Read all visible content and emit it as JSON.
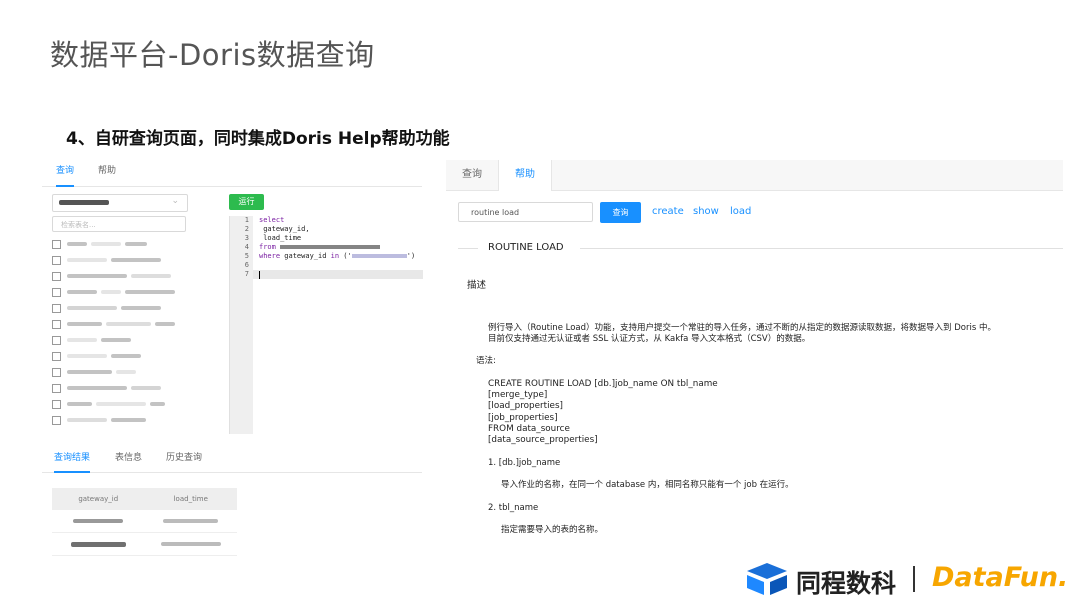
{
  "slide": {
    "title": "数据平台-Doris数据查询",
    "subtitle": "4、自研查询页面，同时集成Doris Help帮助功能"
  },
  "left_panel": {
    "tabs": [
      "查询",
      "帮助"
    ],
    "table_search_placeholder": "检索表名...",
    "run_button": "运行",
    "editor": {
      "line_numbers": [
        "1",
        "2",
        "3",
        "4",
        "5",
        "6",
        "7"
      ],
      "lines": [
        "select",
        " gateway_id,",
        " load_time",
        "from",
        "where gateway_id in ('",
        "",
        ""
      ],
      "keywords": {
        "from": "from",
        "where": "where",
        "in": "in"
      }
    },
    "result_tabs": [
      "查询结果",
      "表信息",
      "历史查询"
    ],
    "result_columns": [
      "gateway_id",
      "load_time"
    ]
  },
  "right_panel": {
    "tabs": [
      "查询",
      "帮助"
    ],
    "search_value": "routine load",
    "search_button": "查询",
    "links": [
      "create",
      "show",
      "load"
    ],
    "doc_title": "ROUTINE LOAD",
    "section_desc": "描述",
    "desc_line1": "例行导入（Routine Load）功能，支持用户提交一个常驻的导入任务，通过不断的从指定的数据源读取数据，将数据导入到 Doris 中。",
    "desc_line2": "目前仅支持通过无认证或者 SSL 认证方式，从 Kakfa 导入文本格式（CSV）的数据。",
    "section_syntax": "语法:",
    "syntax_lines": [
      "CREATE ROUTINE LOAD [db.]job_name ON tbl_name",
      "[merge_type]",
      "[load_properties]",
      "[job_properties]",
      "FROM data_source",
      "[data_source_properties]"
    ],
    "item1": "1. [db.]job_name",
    "item1_desc": "导入作业的名称，在同一个 database 内，相同名称只能有一个 job 在运行。",
    "item2": "2. tbl_name",
    "item2_desc": "指定需要导入的表的名称。"
  },
  "footer": {
    "brand1": "同程数科",
    "brand2": "DataFun."
  },
  "colors": {
    "accent": "#1890ff",
    "run_green": "#2dbb4e",
    "datafun_orange": "#f7a600",
    "logo_blue": "#1a6fd8"
  }
}
